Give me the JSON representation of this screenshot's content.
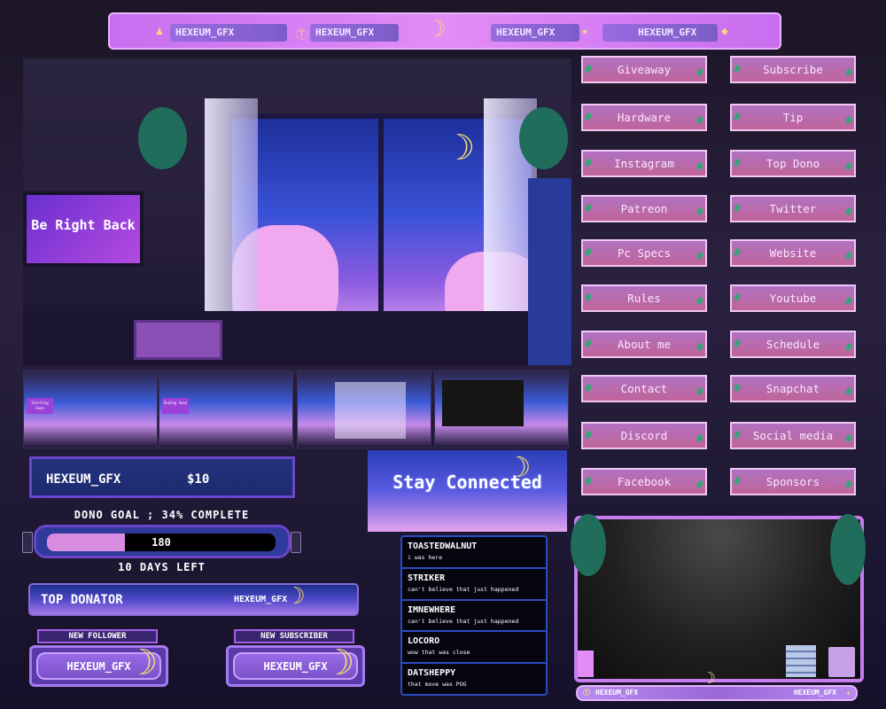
{
  "colors": {
    "accent": "#c86ef0",
    "panel": "#b072c0",
    "chat_border": "#2a4cc0",
    "goal_fill": "#d88ce0",
    "moon": "#f5dc6e",
    "background": "#1b1526"
  },
  "top_bar": {
    "slots": [
      {
        "icon": "person-icon",
        "label": "HEXEUM_GFX"
      },
      {
        "icon": "coin-icon",
        "label": "HEXEUM_GFX"
      },
      {
        "icon": "star-icon",
        "label": "HEXEUM_GFX"
      },
      {
        "icon": "diamond-icon",
        "label": "HEXEUM_GFX"
      }
    ]
  },
  "scene": {
    "monitor_text": "Be Right Back"
  },
  "thumbnails": [
    {
      "screen_text": "Starting Soon"
    },
    {
      "screen_text": "Ending Soon"
    },
    {
      "screen_text": ""
    },
    {
      "screen_text": ""
    }
  ],
  "donation_alert": {
    "name": "HEXEUM_GFX",
    "amount": "$10"
  },
  "dono_goal": {
    "title": "DONO GOAL ; 34% COMPLETE",
    "progress_percent": 34,
    "value": "180",
    "days_left": "10 DAYS LEFT"
  },
  "top_donator": {
    "label": "TOP DONATOR",
    "name": "HEXEUM_GFX"
  },
  "alerts": [
    {
      "label": "NEW FOLLOWER",
      "name": "HEXEUM_GFX"
    },
    {
      "label": "NEW SUBSCRIBER",
      "name": "HEXEUM_GFX"
    }
  ],
  "stay_connected": {
    "text": "Stay Connected"
  },
  "chat": [
    {
      "user": "TOASTEDWALNUT",
      "message": "i was here"
    },
    {
      "user": "STRIKER",
      "message": "can't believe that just happened"
    },
    {
      "user": "IMNEWHERE",
      "message": "can't believe that just happened"
    },
    {
      "user": "LOCORO",
      "message": "wow that was close"
    },
    {
      "user": "DATSHEPPY",
      "message": "that move was POG"
    }
  ],
  "panels": {
    "left": [
      "Giveaway",
      "Hardware",
      "Instagram",
      "Patreon",
      "Pc Specs",
      "Rules",
      "About me",
      "Contact",
      "Discord",
      "Facebook"
    ],
    "right": [
      "Subscribe",
      "Tip",
      "Top Dono",
      "Twitter",
      "Website",
      "Youtube",
      "Schedule",
      "Snapchat",
      "Social media",
      "Sponsors"
    ]
  },
  "webcam_frame": {
    "left_label": "HEXEUM_GFX",
    "right_label": "HEXEUM_GFX"
  }
}
